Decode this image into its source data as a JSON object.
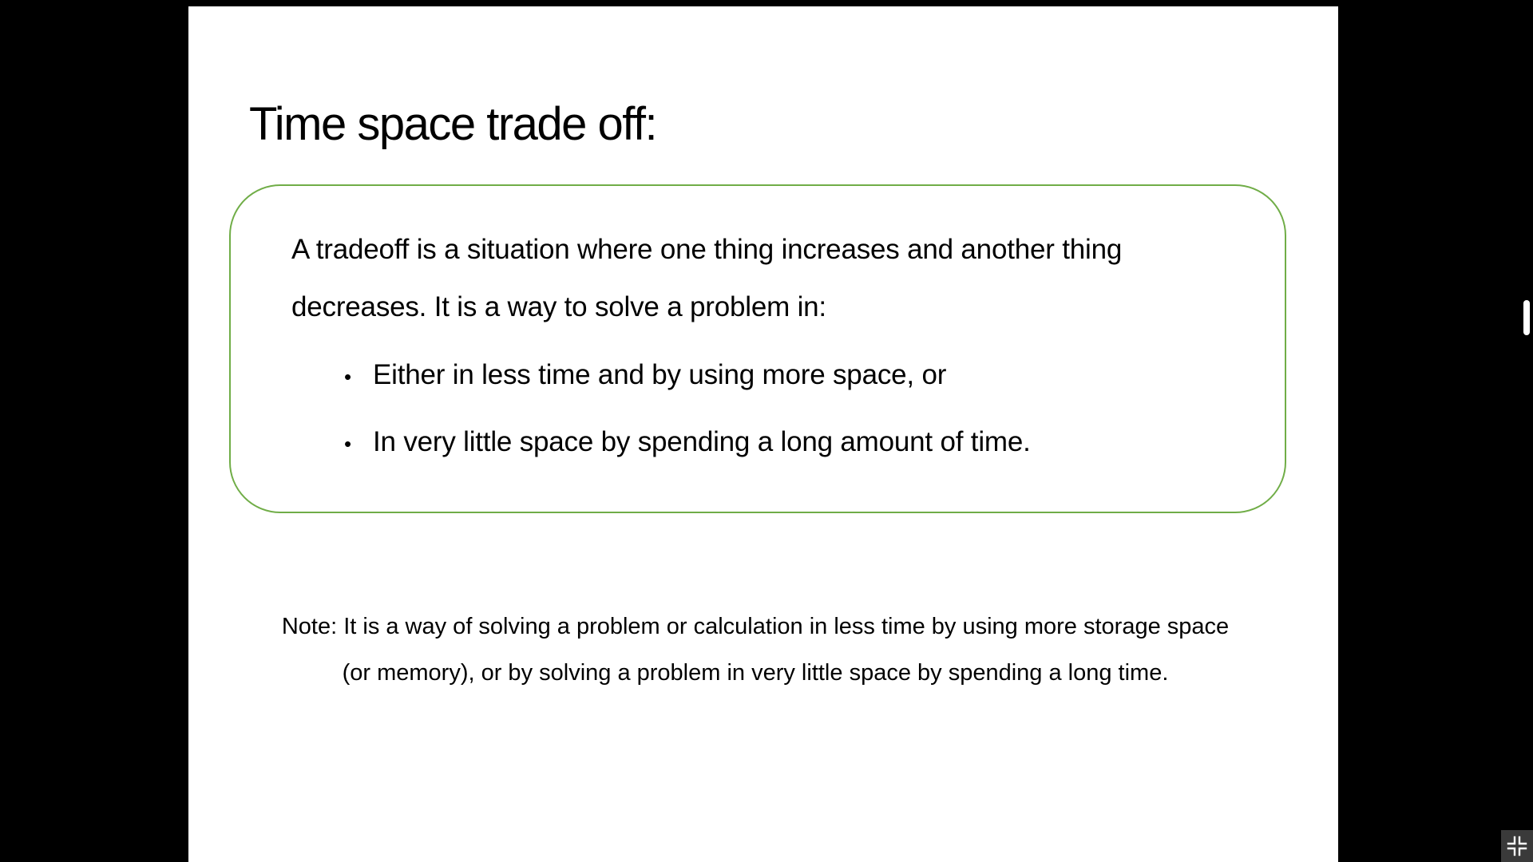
{
  "slide": {
    "title": "Time space trade off:",
    "definition": "A tradeoff is a situation where one thing increases and another thing decreases. It is a way to solve a problem in:",
    "bullets": [
      "Either in less time and by using more space, or",
      "In very little space by spending a long amount of time."
    ],
    "note": "Note: It is a way of solving a problem or calculation in less time by using more storage space (or memory), or by solving a problem in very little space by spending a long time."
  },
  "colors": {
    "box_border": "#70ad47",
    "background": "#000000",
    "slide_background": "#ffffff"
  },
  "icons": {
    "exit_fullscreen": "exit-fullscreen-icon",
    "bullet": "bullet-icon"
  }
}
